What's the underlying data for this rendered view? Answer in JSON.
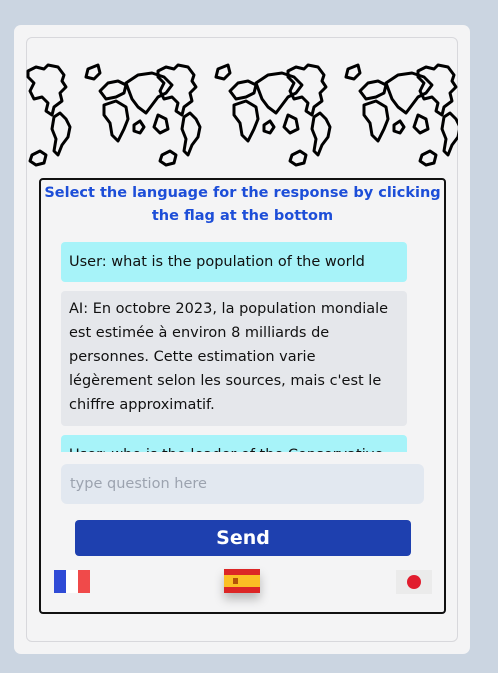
{
  "instruction": {
    "line1": "Select the language for the response by clicking",
    "line2": "the flag at the bottom"
  },
  "chat": {
    "user_message": "User: what is the population of the world",
    "ai_message_lines": [
      "AI: En octobre 2023, la population mondiale",
      "est estimée à environ 8 milliards de",
      "personnes. Cette estimation varie",
      "légèrement selon les sources, mais c'est le",
      "chiffre approximatif."
    ],
    "partial_message": "User: who is the leader of the Conservative"
  },
  "input": {
    "placeholder": "type question here",
    "value": ""
  },
  "send_button": {
    "label": "Send"
  },
  "flags": [
    {
      "name": "french-flag",
      "colors": [
        "#2f4bd6",
        "#ffffff",
        "#f04a4a"
      ]
    },
    {
      "name": "spanish-flag",
      "colors": [
        "#dc2626",
        "#fbbf24"
      ]
    },
    {
      "name": "japanese-flag",
      "colors": [
        "#ebebeb",
        "#e11d2e"
      ]
    }
  ],
  "colors": {
    "accent_blue": "#1d4ed8",
    "send_blue": "#1e40af",
    "user_bubble": "#a7f3f9",
    "ai_bubble": "#e5e7eb",
    "input_bg": "#e2e8f0"
  },
  "icons": [
    "world-map-banner",
    "scroll-up-icon",
    "scroll-down-icon"
  ]
}
